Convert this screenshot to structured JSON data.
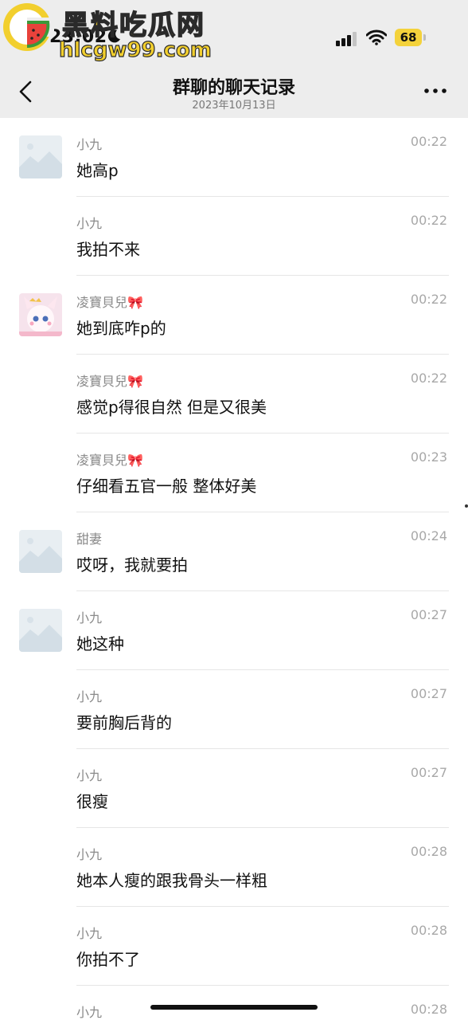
{
  "status_bar": {
    "time": "23:02",
    "battery": "68",
    "moon_icon": "moon-icon",
    "signal_icon": "cellular-signal-icon",
    "wifi_icon": "wifi-icon"
  },
  "watermark": {
    "title": "黑料吃瓜网",
    "url": "hlcgw99.com",
    "logo_icon": "watermelon-logo-icon"
  },
  "nav": {
    "title": "群聊的聊天记录",
    "subtitle": "2023年10月13日",
    "back_icon": "chevron-left-icon",
    "more_icon": "more-dots-icon"
  },
  "colors": {
    "nav_bg": "#ededed",
    "battery": "#f4d23b",
    "watermark_yellow": "#f2cf2e"
  },
  "messages": [
    {
      "sender": "小九",
      "time": "00:22",
      "text": "她高p",
      "avatar": "placeholder"
    },
    {
      "sender": "小九",
      "time": "00:22",
      "text": "我拍不来",
      "avatar": ""
    },
    {
      "sender": "凌寶貝兒🎀",
      "time": "00:22",
      "text": "她到底咋p的",
      "avatar": "anime"
    },
    {
      "sender": "凌寶貝兒🎀",
      "time": "00:22",
      "text": "感觉p得很自然 但是又很美",
      "avatar": ""
    },
    {
      "sender": "凌寶貝兒🎀",
      "time": "00:23",
      "text": "仔细看五官一般 整体好美",
      "avatar": ""
    },
    {
      "sender": "甜妻",
      "time": "00:24",
      "text": "哎呀，我就要拍",
      "avatar": "placeholder"
    },
    {
      "sender": "小九",
      "time": "00:27",
      "text": "她这种",
      "avatar": "placeholder"
    },
    {
      "sender": "小九",
      "time": "00:27",
      "text": "要前胸后背的",
      "avatar": ""
    },
    {
      "sender": "小九",
      "time": "00:27",
      "text": "很瘦",
      "avatar": ""
    },
    {
      "sender": "小九",
      "time": "00:28",
      "text": "她本人瘦的跟我骨头一样粗",
      "avatar": ""
    },
    {
      "sender": "小九",
      "time": "00:28",
      "text": "你拍不了",
      "avatar": ""
    },
    {
      "sender": "小九",
      "time": "00:28",
      "text": "",
      "avatar": ""
    }
  ]
}
